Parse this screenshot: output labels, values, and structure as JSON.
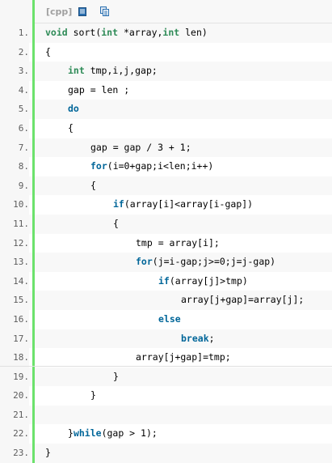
{
  "toolbar": {
    "language_label": "[cpp]",
    "view_icon": "view-plain-icon",
    "copy_icon": "copy-icon"
  },
  "colors": {
    "keyword": "#006699",
    "type": "#2e8b57",
    "gutter_bar": "#6ce26c",
    "line_number": "#5c5c5c",
    "row_alt": "#f8f8f8"
  },
  "lines": [
    {
      "n": "1.",
      "indent": 0,
      "tokens": [
        {
          "t": "void",
          "c": "ty"
        },
        {
          "t": " sort(",
          "c": "pl"
        },
        {
          "t": "int",
          "c": "ty"
        },
        {
          "t": " *array,",
          "c": "pl"
        },
        {
          "t": "int",
          "c": "ty"
        },
        {
          "t": " len)",
          "c": "pl"
        }
      ]
    },
    {
      "n": "2.",
      "indent": 0,
      "tokens": [
        {
          "t": "{",
          "c": "pl"
        }
      ]
    },
    {
      "n": "3.",
      "indent": 1,
      "tokens": [
        {
          "t": "int",
          "c": "ty"
        },
        {
          "t": " tmp,i,j,gap;",
          "c": "pl"
        }
      ]
    },
    {
      "n": "4.",
      "indent": 1,
      "tokens": [
        {
          "t": "gap = len ;",
          "c": "pl"
        }
      ]
    },
    {
      "n": "5.",
      "indent": 1,
      "tokens": [
        {
          "t": "do",
          "c": "kw"
        }
      ]
    },
    {
      "n": "6.",
      "indent": 1,
      "tokens": [
        {
          "t": "{",
          "c": "pl"
        }
      ]
    },
    {
      "n": "7.",
      "indent": 2,
      "tokens": [
        {
          "t": "gap = gap / 3 + 1;",
          "c": "pl"
        }
      ]
    },
    {
      "n": "8.",
      "indent": 2,
      "tokens": [
        {
          "t": "for",
          "c": "kw"
        },
        {
          "t": "(i=0+gap;i<len;i++)",
          "c": "pl"
        }
      ]
    },
    {
      "n": "9.",
      "indent": 2,
      "tokens": [
        {
          "t": "{",
          "c": "pl"
        }
      ]
    },
    {
      "n": "10.",
      "indent": 3,
      "tokens": [
        {
          "t": "if",
          "c": "kw"
        },
        {
          "t": "(array[i]<array[i-gap])",
          "c": "pl"
        }
      ]
    },
    {
      "n": "11.",
      "indent": 3,
      "tokens": [
        {
          "t": "{",
          "c": "pl"
        }
      ]
    },
    {
      "n": "12.",
      "indent": 4,
      "tokens": [
        {
          "t": "tmp = array[i];",
          "c": "pl"
        }
      ]
    },
    {
      "n": "13.",
      "indent": 4,
      "tokens": [
        {
          "t": "for",
          "c": "kw"
        },
        {
          "t": "(j=i-gap;j>=0;j=j-gap)",
          "c": "pl"
        }
      ]
    },
    {
      "n": "14.",
      "indent": 5,
      "tokens": [
        {
          "t": "if",
          "c": "kw"
        },
        {
          "t": "(array[j]>tmp)",
          "c": "pl"
        }
      ]
    },
    {
      "n": "15.",
      "indent": 6,
      "tokens": [
        {
          "t": "array[j+gap]=array[j];",
          "c": "pl"
        }
      ]
    },
    {
      "n": "16.",
      "indent": 5,
      "tokens": [
        {
          "t": "else",
          "c": "kw"
        }
      ]
    },
    {
      "n": "17.",
      "indent": 6,
      "tokens": [
        {
          "t": "break",
          "c": "kw"
        },
        {
          "t": ";",
          "c": "pl"
        }
      ]
    },
    {
      "n": "18.",
      "indent": 4,
      "tokens": [
        {
          "t": "array[j+gap]=tmp;",
          "c": "pl"
        }
      ]
    },
    {
      "n": "19.",
      "indent": 3,
      "tokens": [
        {
          "t": "}",
          "c": "pl"
        }
      ]
    },
    {
      "n": "20.",
      "indent": 2,
      "tokens": [
        {
          "t": "}",
          "c": "pl"
        }
      ]
    },
    {
      "n": "21.",
      "indent": 0,
      "tokens": []
    },
    {
      "n": "22.",
      "indent": 1,
      "tokens": [
        {
          "t": "}",
          "c": "pl"
        },
        {
          "t": "while",
          "c": "kw"
        },
        {
          "t": "(gap > 1);",
          "c": "pl"
        }
      ]
    },
    {
      "n": "23.",
      "indent": 0,
      "tokens": [
        {
          "t": "}",
          "c": "pl"
        }
      ]
    }
  ]
}
